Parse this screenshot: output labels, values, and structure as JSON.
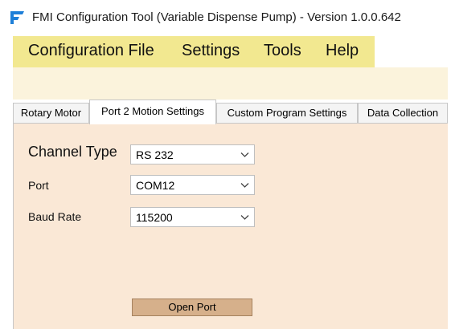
{
  "window": {
    "title": "FMI Configuration Tool (Variable Dispense Pump) - Version 1.0.0.642",
    "icon": "fmi-logo-icon"
  },
  "menu": {
    "items": [
      {
        "label": "Configuration File"
      },
      {
        "label": "Settings"
      },
      {
        "label": "Tools"
      },
      {
        "label": "Help"
      }
    ]
  },
  "tabs": [
    {
      "label": "Rotary Motor",
      "active": false
    },
    {
      "label": "Port 2 Motion Settings",
      "active": true
    },
    {
      "label": "Custom Program Settings",
      "active": false
    },
    {
      "label": "Data Collection",
      "active": false
    }
  ],
  "form": {
    "channel_type": {
      "label": "Channel Type",
      "value": "RS 232"
    },
    "port": {
      "label": "Port",
      "value": "COM12"
    },
    "baud_rate": {
      "label": "Baud Rate",
      "value": "115200"
    }
  },
  "buttons": {
    "open_port": "Open Port"
  },
  "colors": {
    "menubar_bg": "#f2e890",
    "toolstrip_bg": "#fbf3dc",
    "panel_bg": "#fae8d6",
    "button_bg": "#d6b08b",
    "icon_blue": "#1e7fd8"
  }
}
